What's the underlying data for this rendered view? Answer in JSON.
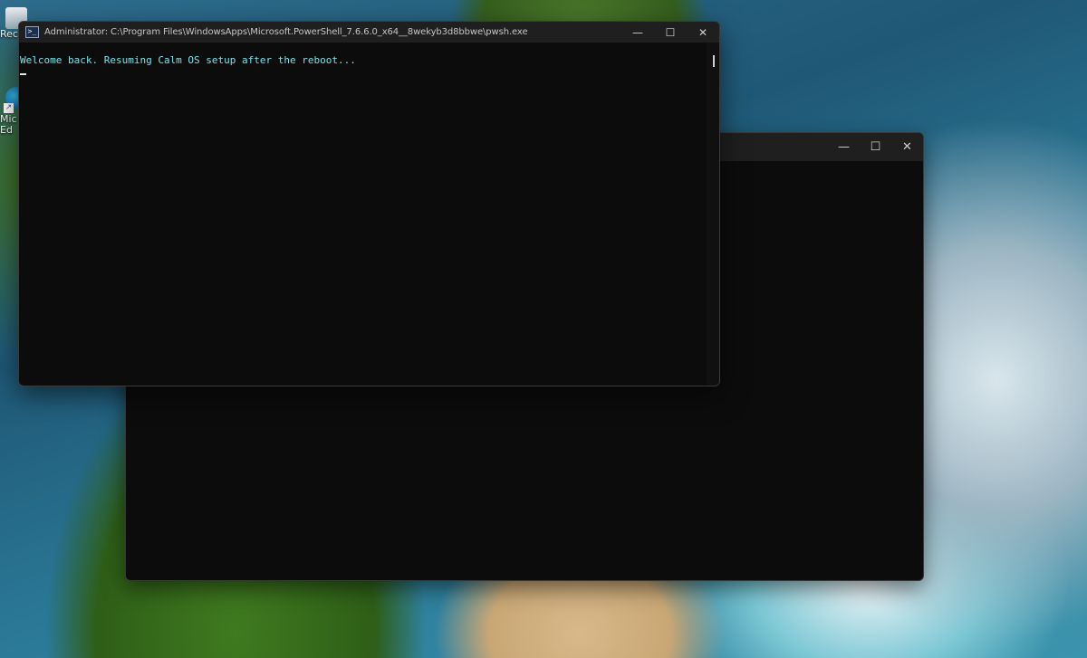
{
  "desktop": {
    "icons": [
      {
        "label": "Recy",
        "icon": "recycle-bin-icon"
      },
      {
        "label": "Mic Ed",
        "icon": "edge-icon"
      }
    ]
  },
  "back_window": {
    "caption": {
      "minimize": "—",
      "maximize": "☐",
      "close": "✕"
    }
  },
  "front_window": {
    "title": "Administrator: C:\\Program Files\\WindowsApps\\Microsoft.PowerShell_7.6.6.0_x64__8wekyb3d8bbwe\\pwsh.exe",
    "app_icon_glyph": ">_",
    "caption": {
      "minimize": "—",
      "maximize": "☐",
      "close": "✕"
    },
    "console_lines": [
      "Welcome back. Resuming Calm OS setup after the reboot..."
    ],
    "text_color": "#7ee0ea"
  }
}
